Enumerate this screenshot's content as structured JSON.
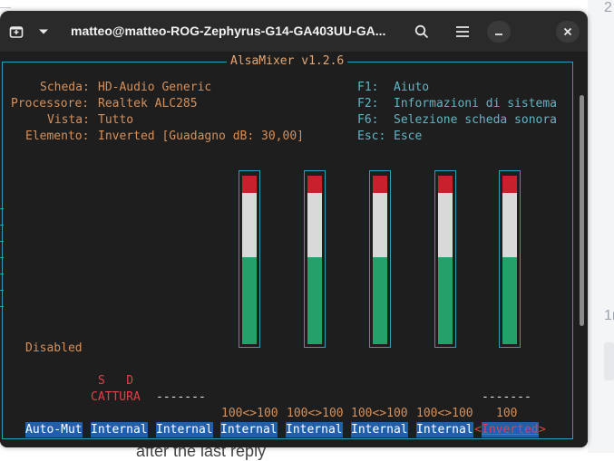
{
  "background": {
    "right_top_text": "2",
    "right_mid_text": "1r",
    "bottom_text": "after the last reply"
  },
  "window": {
    "title": "matteo@matteo-ROG-Zephyrus-G14-GA403UU-GA...",
    "icons": [
      "new-tab-icon",
      "dropdown-icon",
      "search-icon",
      "menu-icon",
      "minimize-icon",
      "close-icon"
    ]
  },
  "mixer": {
    "frame_title": "AlsaMixer v1.2.6",
    "info": [
      {
        "label": "Scheda:",
        "value": "HD-Audio Generic"
      },
      {
        "label": "Processore:",
        "value": "Realtek ALC285"
      },
      {
        "label": "Vista:",
        "value": "Tutto"
      },
      {
        "label": "Elemento:",
        "value": "Inverted [Guadagno dB: 30,00]"
      }
    ],
    "keys": [
      {
        "key": "F1:",
        "action": "Aiuto"
      },
      {
        "key": "F2:",
        "action": "Informazioni di sistema"
      },
      {
        "key": "F6:",
        "action": "Selezione scheda sonora"
      },
      {
        "key": "Esc:",
        "action": "Esce"
      }
    ],
    "disabled_text": "Disabled",
    "capture_sd": "S   D",
    "capture_label": "CATTURA",
    "dashes_1": "-------",
    "dashes_2": "-------",
    "values": [
      "100<>100",
      "100<>100",
      "100<>100",
      "100<>100",
      "100"
    ],
    "meters": [
      {
        "level": 1.0
      },
      {
        "level": 1.0
      },
      {
        "level": 1.0
      },
      {
        "level": 1.0
      },
      {
        "level": 1.0
      }
    ],
    "controls": [
      "Auto-Mut",
      "Internal",
      "Internal",
      "Internal",
      "Internal",
      "Internal",
      "Internal"
    ],
    "selected_control": "Inverted",
    "selected_left": "<",
    "selected_right": ">"
  },
  "colors": {
    "accent_cyan": "#2aa1b3",
    "label_orange": "#d6905a",
    "capture_red": "#e0404a",
    "control_blue": "#1f5fb0",
    "meter_red": "#c8202c",
    "meter_white": "#d9d9d9",
    "meter_green": "#24a06a"
  }
}
